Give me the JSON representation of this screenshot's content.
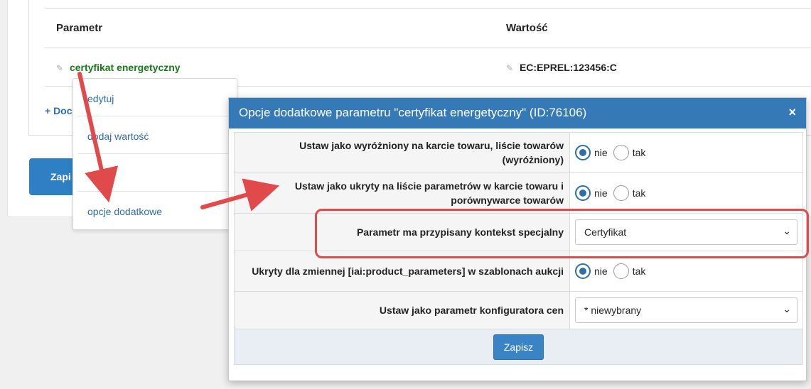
{
  "table": {
    "headers": [
      "Parametr",
      "Wartość"
    ],
    "row": {
      "name": "certyfikat energetyczny",
      "value": "EC:EPREL:123456:C"
    }
  },
  "add_link": "+ Doc",
  "save_bg_label": "Zapi",
  "context_menu": {
    "items": [
      "edytuj",
      "dodaj wartość",
      "usuń",
      "opcje dodatkowe"
    ]
  },
  "modal": {
    "title": "Opcje dodatkowe parametru \"certyfikat energetyczny\" (ID:76106)",
    "close": "×",
    "rows": [
      {
        "label": "Ustaw jako wyróżniony na karcie towaru, liście towarów (wyróżniony)",
        "options": [
          "nie",
          "tak"
        ],
        "selected": "nie"
      },
      {
        "label": "Ustaw jako ukryty na liście parametrów w karcie towaru i porównywarce towarów",
        "options": [
          "nie",
          "tak"
        ],
        "selected": "nie"
      },
      {
        "label": "Parametr ma przypisany kontekst specjalny",
        "select_value": "Certyfikat"
      },
      {
        "label": "Ukryty dla zmiennej [iai:product_parameters] w szablonach aukcji",
        "options": [
          "nie",
          "tak"
        ],
        "selected": "nie"
      },
      {
        "label": "Ustaw jako parametr konfiguratora cen",
        "select_value": "* niewybrany"
      }
    ],
    "save_label": "Zapisz"
  },
  "colors": {
    "accent": "#357ab7",
    "highlight": "#e04a4a",
    "param_green": "#1a7a1a"
  },
  "icons": {
    "pencil": "pencil-icon",
    "chevron": "chevron-down-icon",
    "close": "close-icon"
  }
}
